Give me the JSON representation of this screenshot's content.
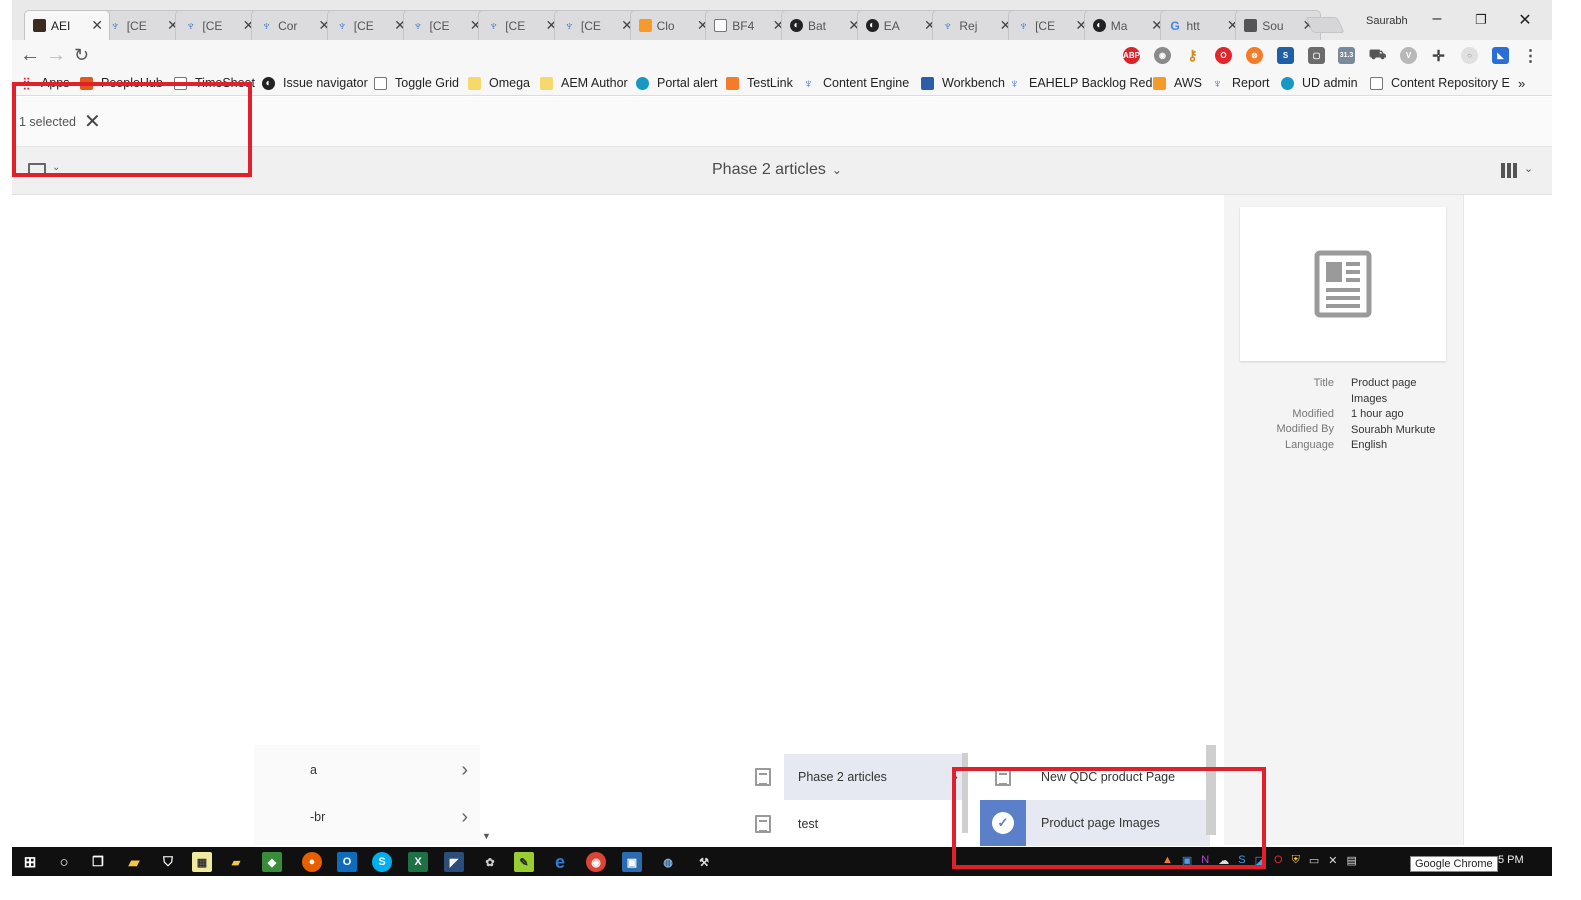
{
  "tabs": [
    {
      "title": "AEI",
      "icon": "aem-icon",
      "active": true
    },
    {
      "title": "[CE",
      "icon": "jira-icon"
    },
    {
      "title": "[CE",
      "icon": "jira-icon"
    },
    {
      "title": "Cor",
      "icon": "jira-icon"
    },
    {
      "title": "[CE",
      "icon": "jira-icon"
    },
    {
      "title": "[CE",
      "icon": "jira-icon"
    },
    {
      "title": "[CE",
      "icon": "jira-icon"
    },
    {
      "title": "[CE",
      "icon": "jira-icon"
    },
    {
      "title": "Clo",
      "icon": "aws-icon"
    },
    {
      "title": "BF4",
      "icon": "document-icon"
    },
    {
      "title": "Bat",
      "icon": "ea-icon"
    },
    {
      "title": "EA",
      "icon": "ea-icon"
    },
    {
      "title": "Rej",
      "icon": "jira-icon"
    },
    {
      "title": "[CE",
      "icon": "jira-icon"
    },
    {
      "title": "Ma",
      "icon": "ea-icon"
    },
    {
      "title": "htt",
      "icon": "google-icon"
    },
    {
      "title": "Sou",
      "icon": "sou-icon"
    }
  ],
  "profile_name": "Saurabh",
  "bookmarks": [
    {
      "label": "Apps",
      "icon": "apps-grid-icon"
    },
    {
      "label": "PeopleHub",
      "icon": "peoplehub-icon"
    },
    {
      "label": "TimeSheet",
      "icon": "document-icon"
    },
    {
      "label": "Issue navigator",
      "icon": "ea-icon"
    },
    {
      "label": "Toggle Grid",
      "icon": "document-icon"
    },
    {
      "label": "Omega",
      "icon": "folder-icon"
    },
    {
      "label": "AEM Author",
      "icon": "folder-icon"
    },
    {
      "label": "Portal alert",
      "icon": "salesforce-icon"
    },
    {
      "label": "TestLink",
      "icon": "testlink-icon"
    },
    {
      "label": "Content Engine",
      "icon": "jira-icon"
    },
    {
      "label": "Workbench",
      "icon": "workbench-icon"
    },
    {
      "label": "EAHELP Backlog Red",
      "icon": "jira-icon"
    },
    {
      "label": "AWS",
      "icon": "aws-icon"
    },
    {
      "label": "Report",
      "icon": "jira-icon"
    },
    {
      "label": "UD admin",
      "icon": "salesforce-icon"
    },
    {
      "label": "Content Repository E",
      "icon": "document-icon"
    }
  ],
  "bookmarks_overflow": "»",
  "selection": {
    "label": "1 selected",
    "close": "✕"
  },
  "header": {
    "title": "Phase 2 articles"
  },
  "columns": {
    "col1": [
      {
        "label": "a",
        "chevron": "›"
      },
      {
        "label": "-br",
        "chevron": "›"
      }
    ],
    "col3": [
      {
        "label": "Phase 2 articles",
        "chevron": "›",
        "selected": true
      },
      {
        "label": "test"
      }
    ],
    "col4": [
      {
        "label": "New QDC product Page"
      },
      {
        "label": "Product page Images",
        "checked": true
      }
    ]
  },
  "details": {
    "title_label": "Title",
    "title_value": "Product page Images",
    "modified_label": "Modified",
    "modified_value": "1 hour ago",
    "modified_by_label": "Modified By",
    "modified_by_value": "Sourabh Murkute",
    "language_label": "Language",
    "language_value": "English"
  },
  "ext_badge": "31.3",
  "clock": "5 PM",
  "tooltip": "Google Chrome",
  "highlight_color": "#e1202b",
  "accent_color": "#5b7fc9"
}
